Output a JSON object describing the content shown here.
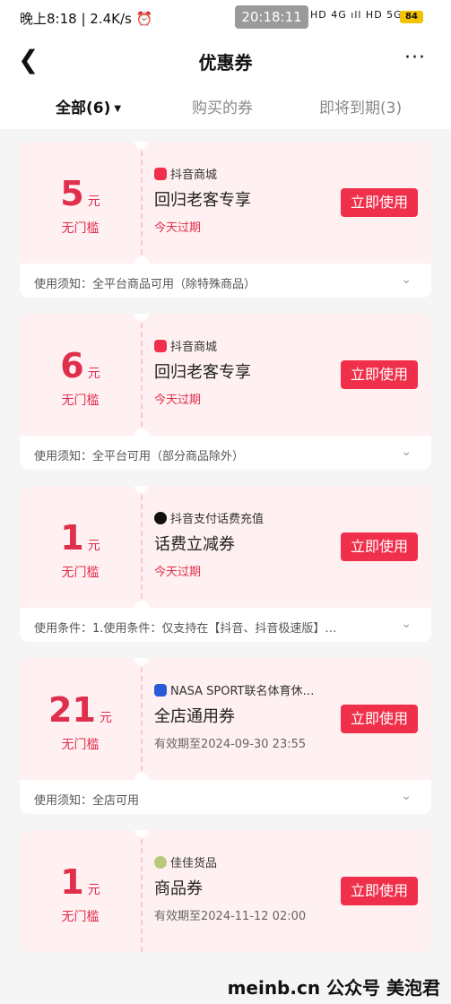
{
  "status_bar": {
    "left": "晚上8:18 | 2.4K/s",
    "alarm_icon": "alarm-icon",
    "time": "20:18:11",
    "signal": "HD 4G ıll HD 5G ıll",
    "battery": "84"
  },
  "nav": {
    "back_icon": "chevron-left-icon",
    "title": "优惠券",
    "more_icon": "more-icon",
    "more": "···"
  },
  "tabs": [
    {
      "label": "全部(6)",
      "active": true
    },
    {
      "label": "购买的券",
      "active": false
    },
    {
      "label": "即将到期(3)",
      "active": false
    }
  ],
  "coupons": [
    {
      "amount": "5",
      "unit": "元",
      "threshold": "无门槛",
      "shop": "抖音商城",
      "shop_icon": "douyin-mall-icon",
      "name": "回归老客专享",
      "expire": "今天过期",
      "expire_red": true,
      "button": "立即使用",
      "note": "使用须知：全平台商品可用（除特殊商品）"
    },
    {
      "amount": "6",
      "unit": "元",
      "threshold": "无门槛",
      "shop": "抖音商城",
      "shop_icon": "douyin-mall-icon",
      "name": "回归老客专享",
      "expire": "今天过期",
      "expire_red": true,
      "button": "立即使用",
      "note": "使用须知：全平台可用（部分商品除外）"
    },
    {
      "amount": "1",
      "unit": "元",
      "threshold": "无门槛",
      "shop": "抖音支付话费充值",
      "shop_icon": "douyin-logo-icon",
      "name": "话费立减券",
      "expire": "今天过期",
      "expire_red": true,
      "button": "立即使用",
      "note": "使用条件：1.使用条件：仅支持在【抖音、抖音极速版】…"
    },
    {
      "amount": "21",
      "unit": "元",
      "threshold": "无门槛",
      "shop": "NASA SPORT联名体育休…",
      "shop_icon": "nasa-sport-icon",
      "name": "全店通用券",
      "expire": "有效期至2024-09-30 23:55",
      "expire_red": false,
      "button": "立即使用",
      "note": "使用须知：全店可用"
    },
    {
      "amount": "1",
      "unit": "元",
      "threshold": "无门槛",
      "shop": "佳佳货品",
      "shop_icon": "jiajia-shop-icon",
      "name": "商品券",
      "expire": "有效期至2024-11-12 02:00",
      "expire_red": false,
      "button": "立即使用",
      "note": ""
    }
  ],
  "colors": {
    "accent": "#f02f4a",
    "coupon_bg": "#fff0f1",
    "amount": "#e02e4d"
  },
  "watermark": "meinb.cn 公众号 美泡君"
}
